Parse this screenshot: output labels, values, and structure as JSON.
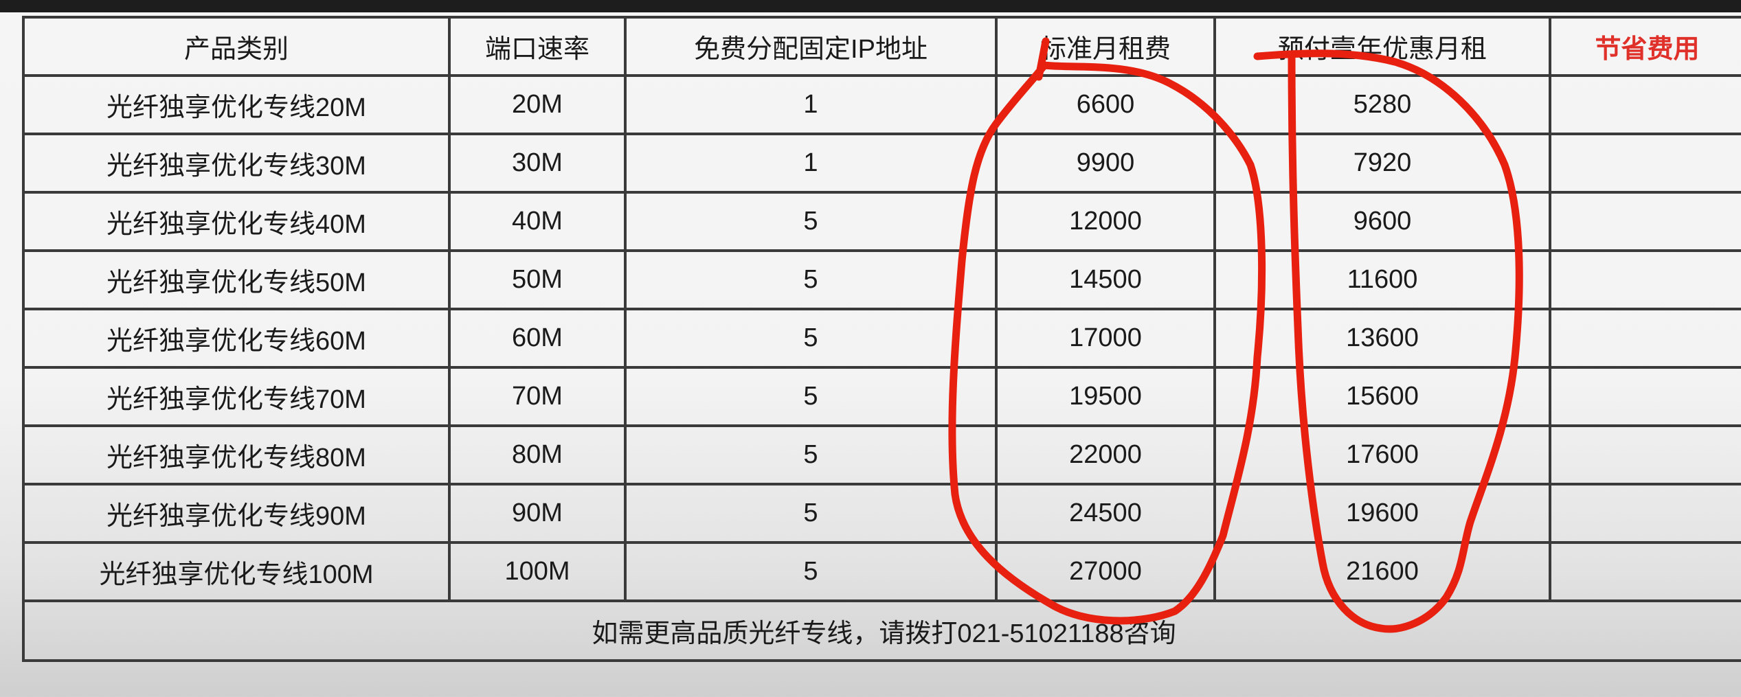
{
  "table": {
    "headers": [
      "产品类别",
      "端口速率",
      "免费分配固定IP地址",
      "标准月租费",
      "预付壹年优惠月租",
      "节省费用"
    ],
    "rows": [
      [
        "光纤独享优化专线20M",
        "20M",
        "1",
        "6600",
        "5280",
        ""
      ],
      [
        "光纤独享优化专线30M",
        "30M",
        "1",
        "9900",
        "7920",
        ""
      ],
      [
        "光纤独享优化专线40M",
        "40M",
        "5",
        "12000",
        "9600",
        ""
      ],
      [
        "光纤独享优化专线50M",
        "50M",
        "5",
        "14500",
        "11600",
        ""
      ],
      [
        "光纤独享优化专线60M",
        "60M",
        "5",
        "17000",
        "13600",
        ""
      ],
      [
        "光纤独享优化专线70M",
        "70M",
        "5",
        "19500",
        "15600",
        ""
      ],
      [
        "光纤独享优化专线80M",
        "80M",
        "5",
        "22000",
        "17600",
        ""
      ],
      [
        "光纤独享优化专线90M",
        "90M",
        "5",
        "24500",
        "19600",
        ""
      ],
      [
        "光纤独享优化专线100M",
        "100M",
        "5",
        "27000",
        "21600",
        ""
      ]
    ],
    "footer": "如需更高品质光纤专线，请拨打021-51021188咨询"
  },
  "colors": {
    "savings_header": "#e0302a",
    "annotation_stroke": "#e8200f",
    "grid_line": "#3a3a3a",
    "top_band": "#1d1d1d"
  }
}
